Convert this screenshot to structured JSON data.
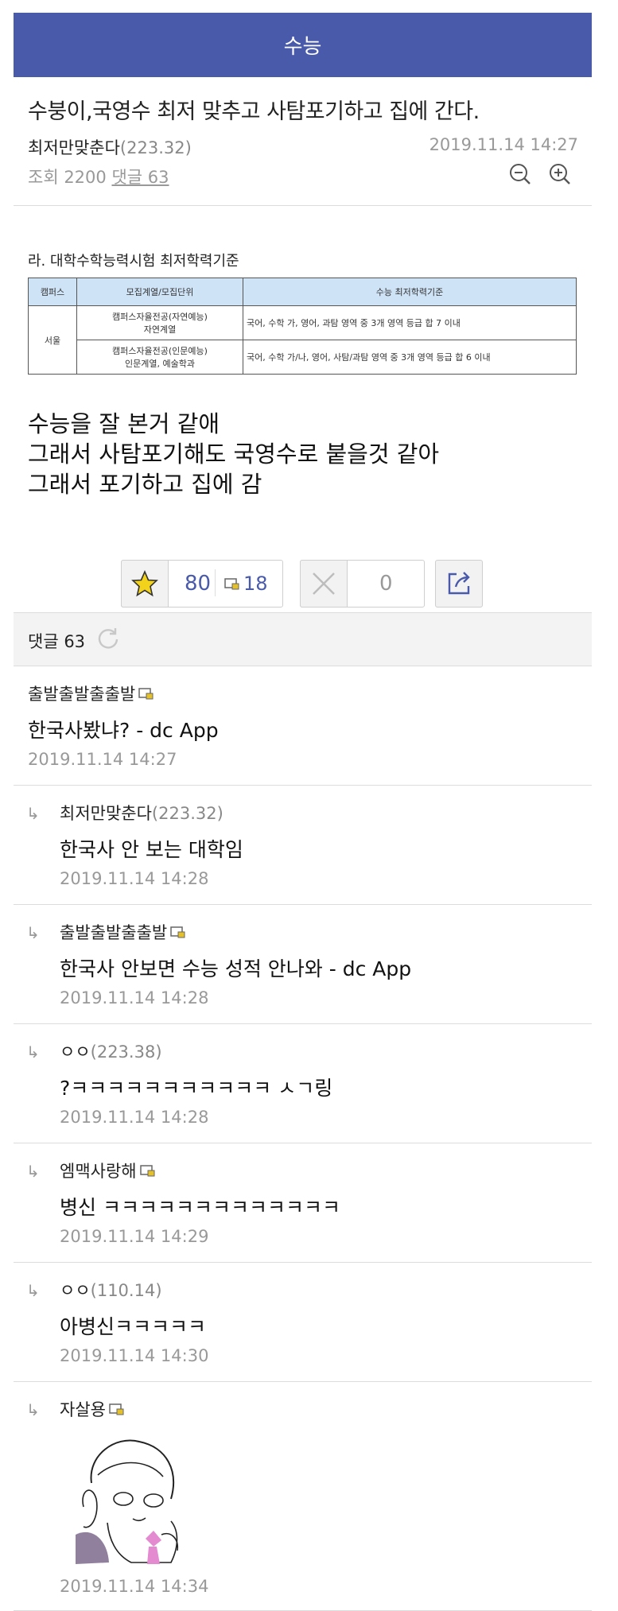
{
  "header": {
    "title": "수능"
  },
  "post": {
    "title": "수붕이,국영수 최저 맞추고 사탐포기하고 집에 간다.",
    "author": "최저만맞춘다",
    "author_ip": "(223.32)",
    "date": "2019.11.14 14:27",
    "views_label": "조회 2200",
    "comment_link": "댓글 63",
    "image_table": {
      "title": "라. 대학수학능력시험 최저학력기준",
      "headers": [
        "캠퍼스",
        "모집계열/모집단위",
        "수능 최저학력기준"
      ],
      "campus": "서울",
      "rows": [
        {
          "unit_line1": "캠퍼스자율전공(자연예능)",
          "unit_line2": "자연계열",
          "criteria": "국어, 수학 가,    영어, 과탐       영역 중 3개 영역 등급 합 7 이내"
        },
        {
          "unit_line1": "캠퍼스자율전공(인문예능)",
          "unit_line2": "인문계열, 예술학과",
          "criteria": "국어, 수학 가/나, 영어, 사탐/과탐 영역 중 3개 영역 등급 합 6 이내"
        }
      ]
    },
    "body_lines": [
      "수능을 잘 본거 같애",
      "그래서 사탐포기해도 국영수로 붙을것 같아",
      "그래서 포기하고 집에 감"
    ]
  },
  "votes": {
    "up": "80",
    "fixed_up": "18",
    "down": "0"
  },
  "comments_header": {
    "label": "댓글 63"
  },
  "comments": [
    {
      "nick": "출발출발출출발",
      "ip": "",
      "fixed": true,
      "text": "한국사봤냐? - dc App",
      "date": "2019.11.14 14:27",
      "reply": false
    },
    {
      "nick": "최저만맞춘다",
      "ip": "(223.32)",
      "fixed": false,
      "text": "한국사 안 보는 대학임",
      "date": "2019.11.14 14:28",
      "reply": true
    },
    {
      "nick": "출발출발출출발",
      "ip": "",
      "fixed": true,
      "text": "한국사 안보면 수능 성적 안나와 - dc App",
      "date": "2019.11.14 14:28",
      "reply": true
    },
    {
      "nick": "ㅇㅇ",
      "ip": "(223.38)",
      "fixed": false,
      "text": "?ㅋㅋㅋㅋㅋㅋㅋㅋㅋㅋㅋ ㅅㄱ링",
      "date": "2019.11.14 14:28",
      "reply": true
    },
    {
      "nick": "엠맥사랑해",
      "ip": "",
      "fixed": true,
      "text": "병신 ㅋㅋㅋㅋㅋㅋㅋㅋㅋㅋㅋㅋㅋ",
      "date": "2019.11.14 14:29",
      "reply": true
    },
    {
      "nick": "ㅇㅇ",
      "ip": "(110.14)",
      "fixed": false,
      "text": "아병신ㅋㅋㅋㅋㅋ",
      "date": "2019.11.14 14:30",
      "reply": true
    },
    {
      "nick": "자살용",
      "ip": "",
      "fixed": true,
      "text": "",
      "date": "2019.11.14 14:34",
      "reply": true
    }
  ],
  "reply_arrow": "↳",
  "colors": {
    "header": "#4a5aab",
    "accent": "#4a5aab",
    "star": "#f2d21b"
  }
}
